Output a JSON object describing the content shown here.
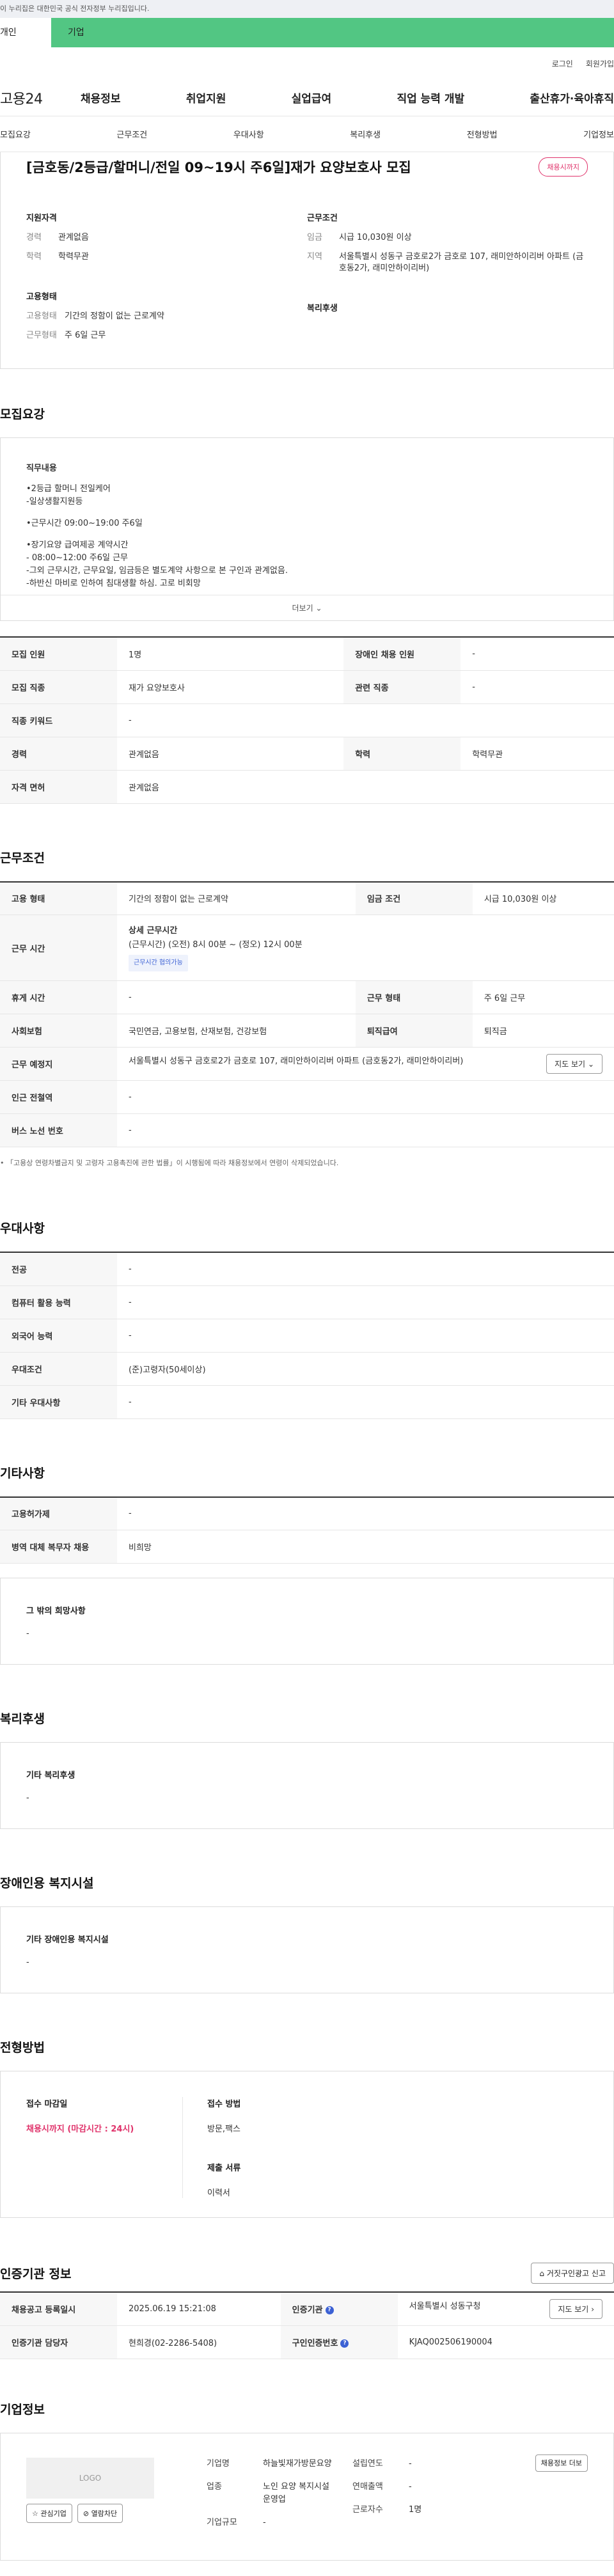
{
  "gov_banner": "이 누리집은 대한민국 공식 전자정부 누리집입니다.",
  "user_tabs": {
    "personal": "개인",
    "company": "기업"
  },
  "top_links": [
    "로그인",
    "회원가입"
  ],
  "logo": "고용24",
  "gnb": [
    "채용정보",
    "취업지원",
    "실업급여",
    "직업 능력 개발",
    "출산휴가·육아휴직"
  ],
  "subnav": [
    "모집요강",
    "근무조건",
    "우대사항",
    "복리후생",
    "전형방법",
    "기업정보"
  ],
  "summary": {
    "title": "[금호동/2등급/할머니/전일 09~19시 주6일]재가 요양보호사 모집",
    "badge": "채용시까지",
    "qual": {
      "heading": "지원자격",
      "career_k": "경력",
      "career_v": "관계없음",
      "edu_k": "학력",
      "edu_v": "학력무관"
    },
    "cond": {
      "heading": "근무조건",
      "wage_k": "임금",
      "wage_v": "시급 10,030원 이상",
      "area_k": "지역",
      "area_v": "서울특별시 성동구 금호로2가 금호로 107, 래미안하이리버 아파트 (금호동2가, 래미안하이리버)"
    },
    "emp": {
      "heading": "고용형태",
      "type_k": "고용형태",
      "type_v": "기간의 정함이 없는 근로계약",
      "work_k": "근무형태",
      "work_v": "주 6일 근무"
    },
    "welfare": {
      "heading": "복리후생"
    }
  },
  "recruit": {
    "title": "모집요강",
    "duty_heading": "직무내용",
    "duty_lines": [
      "•2등급 할머니 전일케어",
      "-일상생활지원등",
      "",
      "•근무시간 09:00~19:00 주6일",
      "",
      "•장기요양 급여제공 계약시간",
      "- 08:00~12:00 주6일 근무",
      "-그외 근무시간, 근무요일, 임금등은 별도계약 사항으로 본 구인과 관계없음.",
      "-하반신 마비로 인하여 침대생활 하심. 고로 비회망"
    ],
    "more": "더보기",
    "rows": {
      "count_h": "모집 인원",
      "count_v": "1명",
      "disabled_h": "장애인 채용 인원",
      "disabled_v": "-",
      "job_h": "모집 직종",
      "job_v": "재가 요양보호사",
      "related_h": "관련 직종",
      "related_v": "-",
      "keyword_h": "직종 키워드",
      "keyword_v": "-",
      "career_h": "경력",
      "career_v": "관계없음",
      "edu_h": "학력",
      "edu_v": "학력무관",
      "license_h": "자격 면허",
      "license_v": "관계없음"
    }
  },
  "condition": {
    "title": "근무조건",
    "emp_type_h": "고용 형태",
    "emp_type_v": "기간의 정함이 없는 근로계약",
    "wage_h": "임금 조건",
    "wage_v": "시급 10,030원 이상",
    "hours_h": "근무 시간",
    "hours_title": "상세 근무시간",
    "hours_detail": "(근무시간) (오전) 8시 00분 ~ (정오) 12시 00분",
    "hours_badge": "근무시간 협의가능",
    "rest_h": "휴게 시간",
    "rest_v": "-",
    "work_type_h": "근무 형태",
    "work_type_v": "주 6일 근무",
    "insurance_h": "사회보험",
    "insurance_v": "국민연금, 고용보험, 산재보험, 건강보험",
    "retire_h": "퇴직급여",
    "retire_v": "퇴직금",
    "place_h": "근무 예정지",
    "place_v": "서울특별시 성동구 금호로2가 금호로 107, 래미안하이리버 아파트 (금호동2가, 래미안하이리버)",
    "map_btn": "지도 보기",
    "station_h": "인근 전철역",
    "station_v": "-",
    "bus_h": "버스 노선 번호",
    "bus_v": "-",
    "note": "「고용상 연령차별금지 및 고령자 고용촉진에 관한 법률」이 시행됨에 따라 채용정보에서 연령이 삭제되었습니다."
  },
  "preference": {
    "title": "우대사항",
    "major_h": "전공",
    "major_v": "-",
    "computer_h": "컴퓨터 활용 능력",
    "computer_v": "-",
    "lang_h": "외국어 능력",
    "lang_v": "-",
    "pref_h": "우대조건",
    "pref_v": "(준)고령자(50세이상)",
    "etc_h": "기타 우대사항",
    "etc_v": "-"
  },
  "other": {
    "title": "기타사항",
    "unemp_h": "고용허가제",
    "unemp_v": "-",
    "military_h": "병역 대체 복무자 채용",
    "military_v": "비희망",
    "etc_heading": "그 밖의 희망사항",
    "etc_v": "-"
  },
  "welfare": {
    "title": "복리후생",
    "heading": "기타 복리후생",
    "value": "-"
  },
  "disability": {
    "title": "장애인용 복지시설",
    "heading": "기타 장애인용 복지시설",
    "value": "-"
  },
  "process": {
    "title": "전형방법",
    "deadline_h": "접수 마감일",
    "deadline_v": "채용시까지 (마감시간 : 24시)",
    "method_h": "접수 방법",
    "method_v": "방문,팩스",
    "docs_h": "제출 서류",
    "docs_v": "이력서"
  },
  "institution": {
    "title": "인증기관 정보",
    "report_btn": "거짓구인광고 신고",
    "reg_h": "채용공고 등록일시",
    "reg_v": "2025.06.19 15:21:08",
    "org_h": "인증기관",
    "org_v": "서울특별시 성동구청",
    "map_btn": "지도 보기",
    "manager_h": "인증기관 담당자",
    "manager_v": "현희경(02-2286-5408)",
    "cert_h": "구인인증번호",
    "cert_v": "KJAQ002506190004"
  },
  "company": {
    "title": "기업정보",
    "logo": "LOGO",
    "fav_btn": "관심기업",
    "block_btn": "열람차단",
    "name_k": "기업명",
    "name_v": "하늘빛재가방문요양",
    "industry_k": "업종",
    "industry_v": "노인 요양 복지시설 운영업",
    "size_k": "기업규모",
    "size_v": "-",
    "founded_k": "설립연도",
    "founded_v": "-",
    "sales_k": "연매출액",
    "sales_v": "-",
    "employees_k": "근로자수",
    "employees_v": "1명",
    "detail_btn": "채용정보 더보"
  }
}
